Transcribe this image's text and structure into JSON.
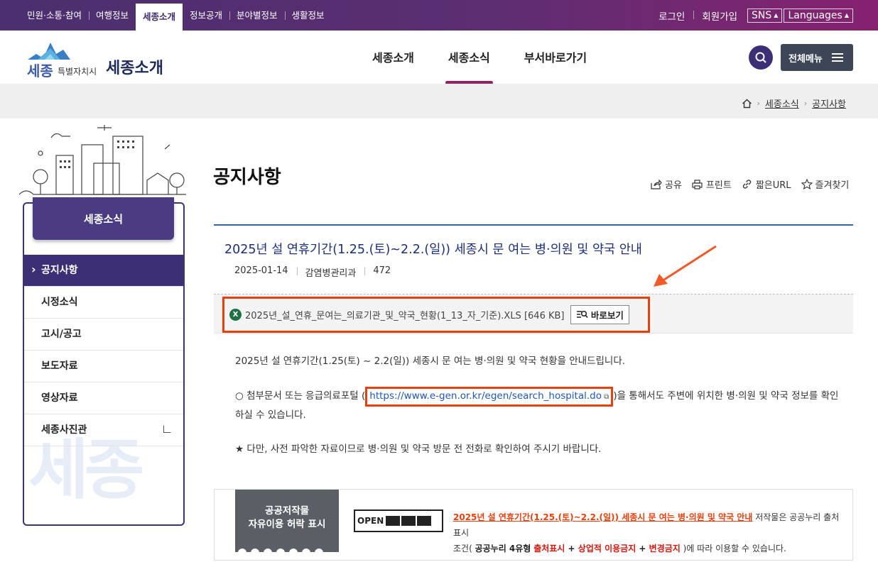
{
  "topnav": {
    "items": [
      "민원·소통·참여",
      "여행정보",
      "세종소개",
      "정보공개",
      "분야별정보",
      "생활정보"
    ],
    "active_index": 2,
    "login": "로그인",
    "signup": "회원가입",
    "sns": "SNS",
    "languages": "Languages"
  },
  "header": {
    "logo_text": "세종",
    "logo_sub": "특별자치시",
    "site_title": "세종소개",
    "gnb": [
      "세종소개",
      "세종소식",
      "부서바로가기"
    ],
    "gnb_active_index": 1,
    "allmenu_label": "전체메뉴"
  },
  "breadcrumb": {
    "level1": "세종소식",
    "level2": "공지사항"
  },
  "sidebar": {
    "title": "세종소식",
    "items": [
      "공지사항",
      "시정소식",
      "고시/공고",
      "보도자료",
      "영상자료",
      "세종사진관"
    ],
    "active_index": 0,
    "watermark": "세종"
  },
  "page": {
    "title": "공지사항",
    "tools": [
      "공유",
      "프린트",
      "짧은URL",
      "즐겨찾기"
    ]
  },
  "post": {
    "title": "2025년 설 연휴기간(1.25.(토)~2.2.(일)) 세종시 문 여는 병·의원 및 약국 안내",
    "date": "2025-01-14",
    "department": "감염병관리과",
    "views": "472",
    "attachment_name": "2025년_설_연휴_문여는_의료기관_및_약국_현황(1_13_자_기준).XLS",
    "attachment_size": "[646 KB]",
    "preview_label": "바로보기",
    "para1": "2025년 설 연휴기간(1.25(토) ~ 2.2(일)) 세종시 문 여는 병·의원 및 약국 현황을 안내드립니다.",
    "para2_before": "○ 첨부문서 또는 응급의료포털 (",
    "para2_link": "https://www.e-gen.or.kr/egen/search_hospital.do",
    "para2_after": ")을 통해서도 주변에 위치한 병·의원 및 약국 정보를 확인하실 수 있습니다.",
    "para3": "★ 다만, 사전 파악한 자료이므로 병·의원 및 약국 방문 전 전화로 확인하여 주시기 바랍니다."
  },
  "license": {
    "label_line1": "공공저작물",
    "label_line2": "자유이용 허락 표시",
    "badge": "OPEN",
    "work_title": "2025년 설 연휴기간(1.25.(토)~2.2.(일)) 세종시 문 여는 병·의원 및 약국 안내",
    "text1": " 저작물은 공공누리 출처표시",
    "text2_pre": "조건( ",
    "type": "공공누리 4유형",
    "cond1": "출처표시",
    "plus1": " + ",
    "cond2": "상업적 이용금지",
    "plus2": " + ",
    "cond3": "변경금지",
    "text2_post": " )에 따라 이용할 수 있습니다."
  },
  "colors": {
    "topbar": "#5c2e72",
    "primary": "#3d2f75",
    "accent_highlight": "#e8400c",
    "link": "#2057b7"
  }
}
